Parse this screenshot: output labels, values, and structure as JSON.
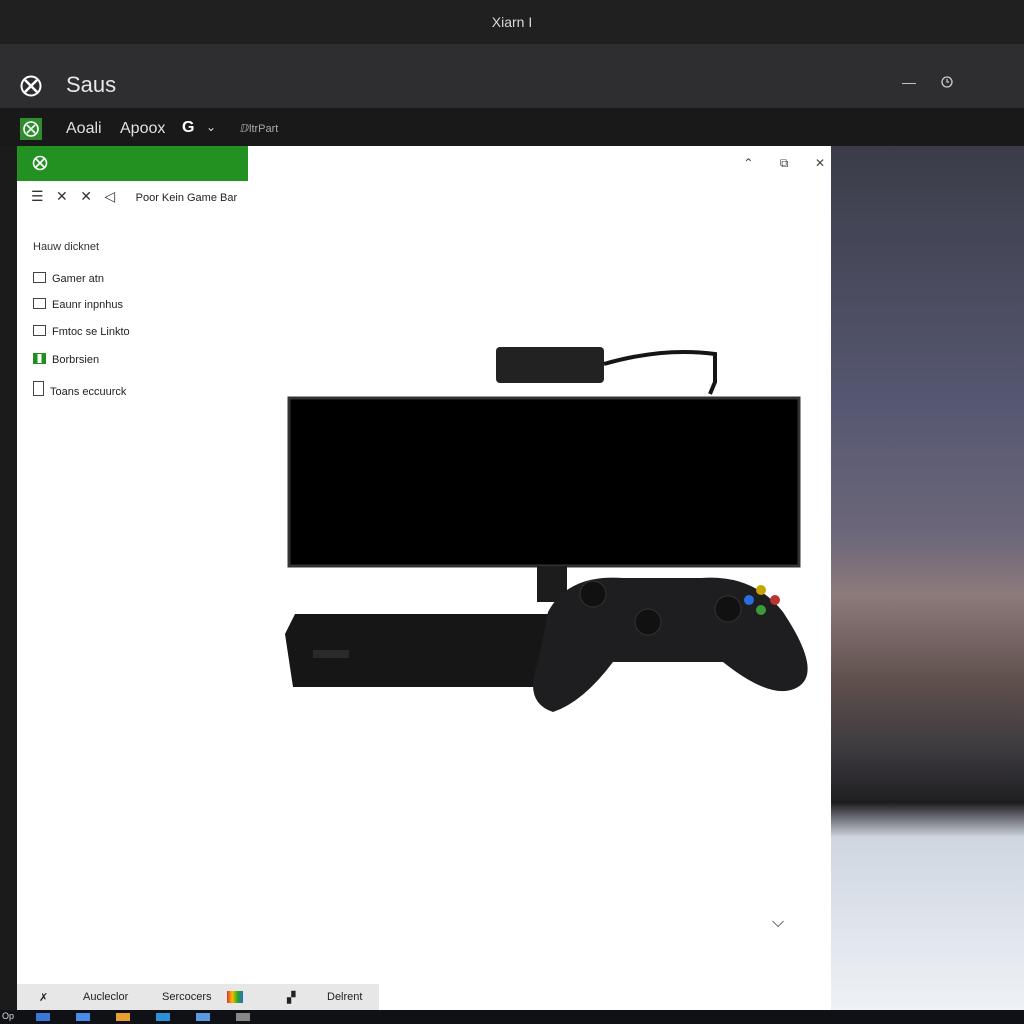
{
  "window": {
    "title": "Xiarn I"
  },
  "app": {
    "name": "Saus",
    "minimize_label": "—"
  },
  "nav": {
    "items": [
      "Aoali",
      "Apoox"
    ],
    "g_label": "G",
    "chevron": "⌄",
    "small_label": "ⅅltrPart"
  },
  "panel": {
    "controls": [
      "⌃",
      "⧉",
      "✕"
    ],
    "toolbar": {
      "icons": [
        "☰",
        "✕",
        "✕"
      ],
      "breadcrumb": "Poor Kein Game Bar"
    },
    "section_title": "Hauw dicknet",
    "menu": [
      {
        "label": "Gamer atn",
        "icon": "monitor-icon"
      },
      {
        "label": "Eaunr inpnhus",
        "icon": "keyboard-icon"
      },
      {
        "label": "Fmtoc se Linkto",
        "icon": "display-icon"
      },
      {
        "label": "Borbrsien",
        "icon": "chart-icon"
      },
      {
        "label": "Toans eccuurck",
        "icon": "document-icon"
      }
    ],
    "expand_icon": "⌵"
  },
  "bottombar": {
    "items": [
      "Aucleclor",
      "Sercocers",
      "Delrent"
    ]
  },
  "taskbar": {
    "start": "Op"
  }
}
